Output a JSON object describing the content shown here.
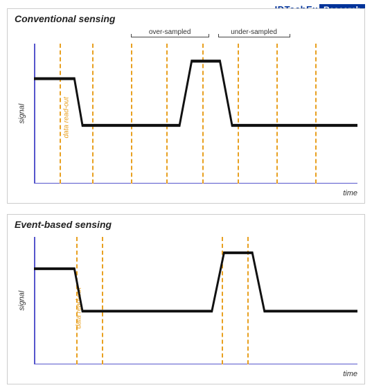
{
  "logo": {
    "brand": "IDTechEx",
    "badge": "Research"
  },
  "panel1": {
    "title": "Conventional sensing",
    "axis_x": "time",
    "axis_y": "signal",
    "data_readout_label": "data read-out",
    "over_sampled_label": "over-sampled",
    "under_sampled_label": "under-sampled"
  },
  "panel2": {
    "title": "Event-based sensing",
    "axis_x": "time",
    "axis_y": "signal",
    "data_readout_label": "data read-out"
  }
}
